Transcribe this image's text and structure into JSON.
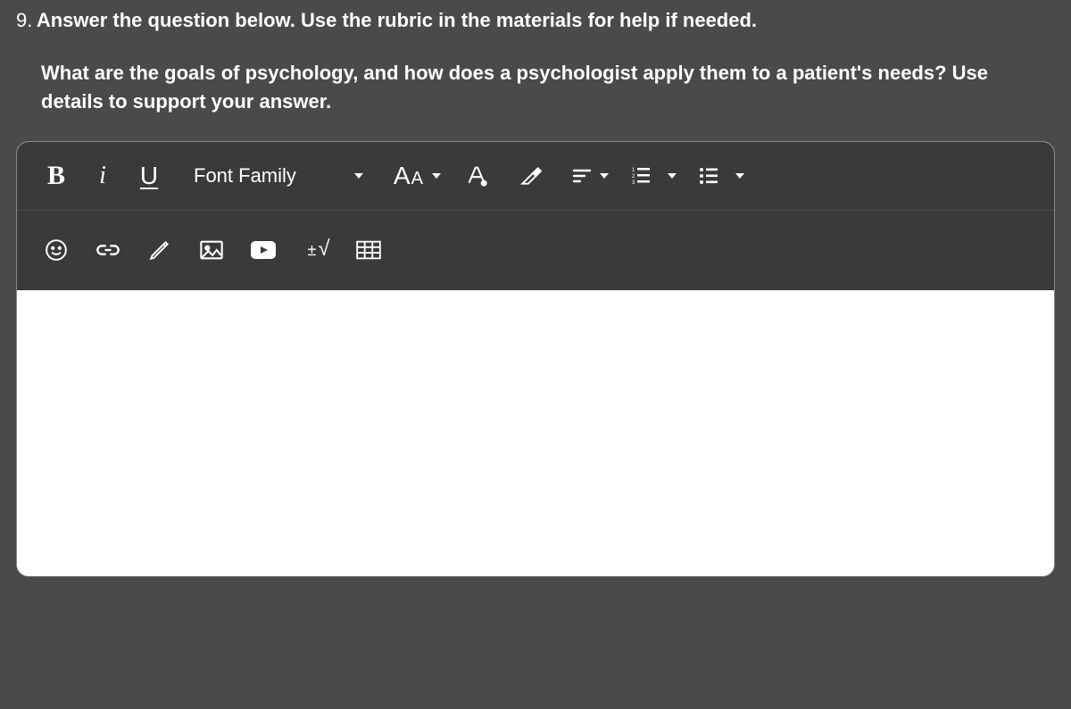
{
  "question": {
    "number": "9.",
    "instruction": "Answer the question below. Use the rubric in the materials for help if needed.",
    "prompt": "What are the goals of psychology, and how does a psychologist apply them to a patient's needs? Use details to support your answer."
  },
  "toolbar": {
    "bold": "B",
    "italic": "i",
    "underline": "U",
    "font_family_label": "Font Family",
    "font_size_big": "A",
    "font_size_small": "A",
    "math_plusminus": "±",
    "math_radical": "√"
  },
  "editor": {
    "content": ""
  }
}
